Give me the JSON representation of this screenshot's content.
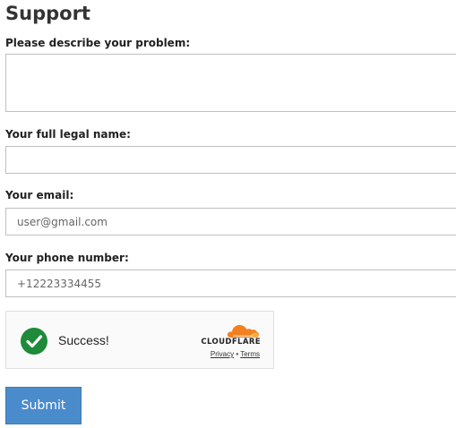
{
  "page": {
    "title": "Support"
  },
  "form": {
    "problem_label": "Please describe your problem:",
    "problem_value": "",
    "name_label": "Your full legal name:",
    "name_value": "",
    "email_label": "Your email:",
    "email_placeholder": "user@gmail.com",
    "phone_label": "Your phone number:",
    "phone_placeholder": "+12223334455",
    "submit_label": "Submit"
  },
  "captcha": {
    "status_text": "Success!",
    "status_icon": "check-circle-icon",
    "status_color": "#1e8a3a",
    "brand": "CLOUDFLARE",
    "brand_color": "#f38020",
    "privacy_link": "Privacy",
    "separator": "•",
    "terms_link": "Terms"
  },
  "colors": {
    "submit_bg": "#4a8bcb",
    "field_border": "#bfbfbf"
  }
}
